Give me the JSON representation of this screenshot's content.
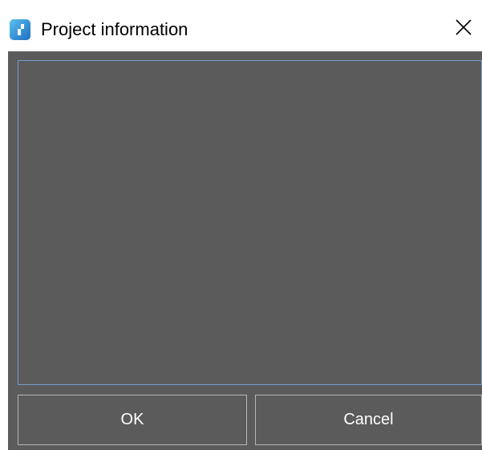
{
  "window": {
    "title": "Project information",
    "app_icon": "app-logo-icon",
    "close_icon": "close-icon"
  },
  "content": {
    "info_text": ""
  },
  "buttons": {
    "ok_label": "OK",
    "cancel_label": "Cancel"
  },
  "colors": {
    "client_background": "#5b5b5b",
    "focus_border": "#7a9cc8",
    "button_border": "#b5b5b5",
    "app_icon_blue": "#2f8fd6"
  }
}
